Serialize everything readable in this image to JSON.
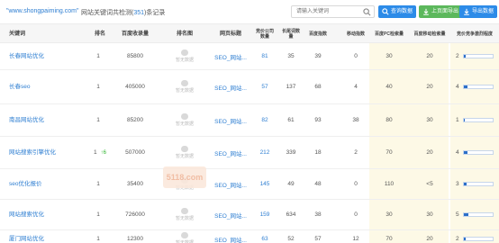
{
  "header": {
    "domain": "\"www.shongpaiming.com\"",
    "summary_prefix": "网站关键词共检测(",
    "summary_count": "351",
    "summary_suffix": ")条记录",
    "search_placeholder": "请输入关键词",
    "btn_query": "查询数据",
    "btn_import": "上页面导出",
    "btn_export": "导出数据"
  },
  "columns": {
    "keyword": "关键词",
    "rank": "排名",
    "baidu_index": "百度收录量",
    "thumb": "排名图",
    "page_title": "网页标题",
    "pc_competition": "竞价公司数量",
    "long_tail": "长尾词数量",
    "pc_index": "百度指数",
    "mobile_index": "移动指数",
    "pc_search": "百度PC检索量",
    "mobile_search": "百度移动检索量",
    "competition_level": "竞价竞争激烈程度"
  },
  "no_pic_label": "暂无数据",
  "watermark": "5118.com",
  "rows": [
    {
      "keyword": "长春网站优化",
      "rank": "1",
      "badge": "",
      "baidu": "85800",
      "title": "SEO_网站...",
      "pc_comp": "81",
      "long_tail": "35",
      "pc_idx": "39",
      "mob_idx": "0",
      "pc_search": "30",
      "mob_search": "20",
      "level": "2",
      "level_pct": 0.06
    },
    {
      "keyword": "长春seo",
      "rank": "1",
      "badge": "",
      "baidu": "405000",
      "title": "SEO_网站...",
      "pc_comp": "57",
      "long_tail": "137",
      "pc_idx": "68",
      "mob_idx": "4",
      "pc_search": "40",
      "mob_search": "20",
      "level": "4",
      "level_pct": 0.12
    },
    {
      "keyword": "南昌网站优化",
      "rank": "1",
      "badge": "",
      "baidu": "85200",
      "title": "SEO_网站...",
      "pc_comp": "82",
      "long_tail": "61",
      "pc_idx": "93",
      "mob_idx": "38",
      "pc_search": "80",
      "mob_search": "30",
      "level": "1",
      "level_pct": 0.03
    },
    {
      "keyword": "网站搜索引擎优化",
      "rank": "1",
      "badge": "↑6",
      "baidu": "507000",
      "title": "SEO_网站...",
      "pc_comp": "212",
      "long_tail": "339",
      "pc_idx": "18",
      "mob_idx": "2",
      "pc_search": "70",
      "mob_search": "20",
      "level": "4",
      "level_pct": 0.12
    },
    {
      "keyword": "seo优化报价",
      "rank": "1",
      "badge": "",
      "baidu": "35400",
      "title": "SEO_网站...",
      "pc_comp": "145",
      "long_tail": "49",
      "pc_idx": "48",
      "mob_idx": "0",
      "pc_search": "110",
      "mob_search": "<5",
      "level": "3",
      "level_pct": 0.09
    },
    {
      "keyword": "网站搜索优化",
      "rank": "1",
      "badge": "",
      "baidu": "726000",
      "title": "SEO_网站...",
      "pc_comp": "159",
      "long_tail": "634",
      "pc_idx": "38",
      "mob_idx": "0",
      "pc_search": "30",
      "mob_search": "30",
      "level": "5",
      "level_pct": 0.15
    },
    {
      "keyword": "厦门网站优化",
      "rank": "1",
      "badge": "",
      "baidu": "12300",
      "title": "SEO_网站...",
      "pc_comp": "63",
      "long_tail": "52",
      "pc_idx": "57",
      "mob_idx": "12",
      "pc_search": "70",
      "mob_search": "20",
      "level": "2",
      "level_pct": 0.06
    }
  ]
}
